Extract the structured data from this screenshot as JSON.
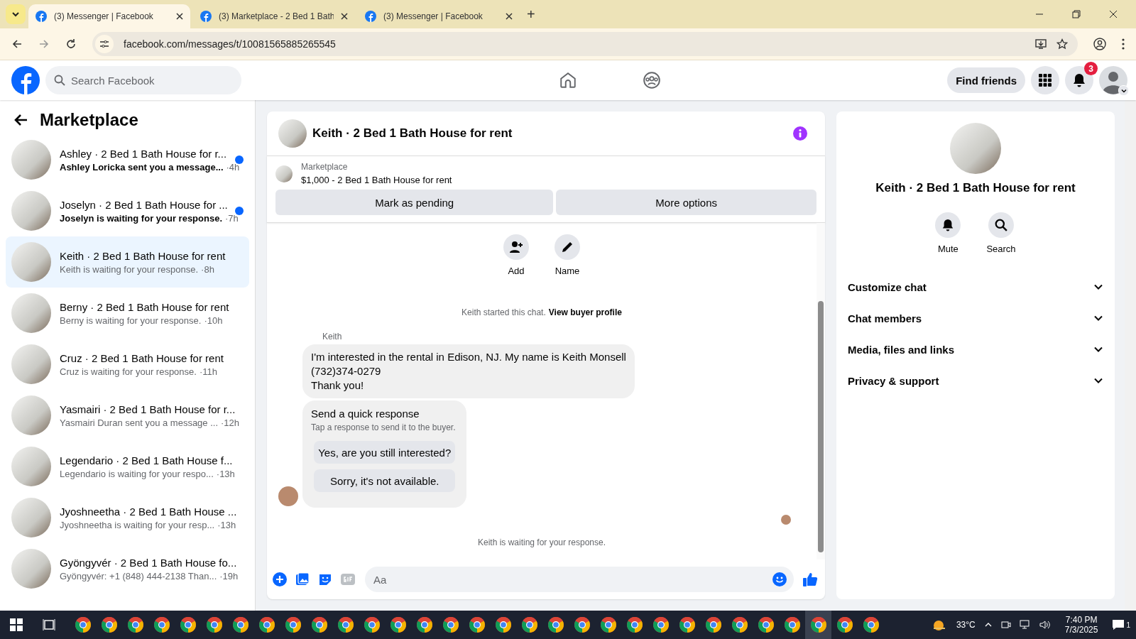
{
  "browser": {
    "tabs": [
      {
        "title": "(3) Messenger | Facebook",
        "selected": true
      },
      {
        "title": "(3) Marketplace - 2 Bed 1 Bath",
        "selected": false
      },
      {
        "title": "(3) Messenger | Facebook",
        "selected": false
      }
    ],
    "new_tab": "+",
    "url": "facebook.com/messages/t/10081565885265545"
  },
  "topnav": {
    "search_placeholder": "Search Facebook",
    "find_friends": "Find friends",
    "notifications_badge": "3"
  },
  "sidebar": {
    "title": "Marketplace",
    "items": [
      {
        "title": "Ashley · 2 Bed 1 Bath House for r...",
        "preview": "Ashley Loricka sent you a message...",
        "time": "·4h",
        "unread": true,
        "selected": false
      },
      {
        "title": "Joselyn · 2 Bed 1 Bath House for ...",
        "preview": "Joselyn is waiting for your response.",
        "time": "·7h",
        "unread": true,
        "selected": false
      },
      {
        "title": "Keith · 2 Bed 1 Bath House for rent",
        "preview": "Keith is waiting for your response.",
        "time": "·8h",
        "unread": false,
        "selected": true
      },
      {
        "title": "Berny · 2 Bed 1 Bath House for rent",
        "preview": "Berny is waiting for your response.",
        "time": "·10h",
        "unread": false,
        "selected": false
      },
      {
        "title": "Cruz · 2 Bed 1 Bath House for rent",
        "preview": "Cruz is waiting for your response.",
        "time": "·11h",
        "unread": false,
        "selected": false
      },
      {
        "title": "Yasmairi · 2 Bed 1 Bath House for r...",
        "preview": "Yasmairi Duran sent you a message ...",
        "time": "·12h",
        "unread": false,
        "selected": false
      },
      {
        "title": "Legendario · 2 Bed 1 Bath House f...",
        "preview": "Legendario is waiting for your respo...",
        "time": "·13h",
        "unread": false,
        "selected": false
      },
      {
        "title": "Jyoshneetha · 2 Bed 1 Bath House ...",
        "preview": "Jyoshneetha is waiting for your resp...",
        "time": "·13h",
        "unread": false,
        "selected": false
      },
      {
        "title": "Gyöngyvér · 2 Bed 1 Bath House fo...",
        "preview": "Gyöngyvér: +1 (848) 444-2138 Than...",
        "time": "·19h",
        "unread": false,
        "selected": false
      }
    ]
  },
  "chat": {
    "title": "Keith · 2 Bed 1 Bath House for rent",
    "listing_label": "Marketplace",
    "listing": "$1,000 - 2 Bed 1 Bath House for rent",
    "buttons": [
      "Mark as pending",
      "More options"
    ],
    "actions": [
      {
        "kind": "add",
        "label": "Add"
      },
      {
        "kind": "name",
        "label": "Name"
      }
    ],
    "started": "Keith started this chat.",
    "view_profile": "View buyer profile",
    "sender": "Keith",
    "message": [
      "I'm interested in the rental in Edison, NJ. My name is Keith Monsell",
      "(732)374-0279",
      "Thank you!"
    ],
    "quick_title": "Send a quick response",
    "quick_hint": "Tap a response to send it to the buyer.",
    "quick_replies": [
      "Yes, are you still interested?",
      "Sorry, it's not available."
    ],
    "status": "Keith is waiting for your response.",
    "composer_placeholder": "Aa"
  },
  "details": {
    "title": "Keith · 2 Bed 1 Bath House for rent",
    "actions": [
      {
        "kind": "mute",
        "label": "Mute"
      },
      {
        "kind": "search",
        "label": "Search"
      }
    ],
    "sections": [
      {
        "label": "Customize chat",
        "expanded": false
      },
      {
        "label": "Chat members",
        "expanded": false
      },
      {
        "label": "Media, files and links",
        "expanded": false
      },
      {
        "label": "Privacy & support",
        "expanded": false
      }
    ]
  },
  "taskbar": {
    "apps": [
      {
        "selected": false
      },
      {
        "selected": false
      },
      {
        "selected": false
      },
      {
        "selected": false
      },
      {
        "selected": false
      },
      {
        "selected": false
      },
      {
        "selected": false
      },
      {
        "selected": false
      },
      {
        "selected": false
      },
      {
        "selected": false
      },
      {
        "selected": false
      },
      {
        "selected": false
      },
      {
        "selected": false
      },
      {
        "selected": false
      },
      {
        "selected": false
      },
      {
        "selected": false
      },
      {
        "selected": false
      },
      {
        "selected": false
      },
      {
        "selected": false
      },
      {
        "selected": false
      },
      {
        "selected": false
      },
      {
        "selected": false
      },
      {
        "selected": false
      },
      {
        "selected": false
      },
      {
        "selected": false
      },
      {
        "selected": false
      },
      {
        "selected": false
      },
      {
        "selected": false
      },
      {
        "selected": true
      },
      {
        "selected": false
      },
      {
        "selected": false
      }
    ],
    "weather": "33°C",
    "time": "7:40 PM",
    "date": "7/3/2025",
    "notification_count": "1"
  }
}
